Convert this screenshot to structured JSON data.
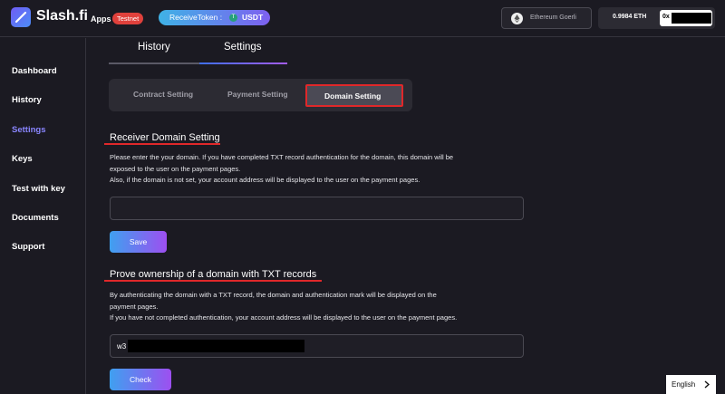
{
  "header": {
    "brand": "Slash.fi",
    "apps_label": "Apps",
    "env_badge": "Testnet",
    "token_pill": {
      "label": "ReceiveToken :",
      "token": "USDT",
      "token_icon": "tether-icon"
    },
    "network": {
      "label": "Ethereum Goerli",
      "icon": "ethereum-icon"
    },
    "balance": "0.9984 ETH",
    "address_prefix": "0x"
  },
  "sidebar": {
    "items": [
      {
        "label": "Dashboard",
        "active": false
      },
      {
        "label": "History",
        "active": false
      },
      {
        "label": "Settings",
        "active": true
      },
      {
        "label": "Keys",
        "active": false
      },
      {
        "label": "Test with key",
        "active": false
      },
      {
        "label": "Documents",
        "active": false
      },
      {
        "label": "Support",
        "active": false
      }
    ],
    "active_color": "#8a86ff"
  },
  "main_tabs": [
    {
      "label": "History",
      "active": false
    },
    {
      "label": "Settings",
      "active": true
    }
  ],
  "setting_tabs": [
    {
      "label": "Contract Setting",
      "active": false
    },
    {
      "label": "Payment Setting",
      "active": false
    },
    {
      "label": "Domain Setting",
      "active": true
    }
  ],
  "receiver_domain": {
    "title": "Receiver Domain Setting",
    "line1": "Please enter the your domain. If you have completed TXT record authentication for the domain, this domain will be",
    "line2": "exposed to the user on the payment pages.",
    "line3": "Also, if the domain is not set, your account address will be displayed to the user on the payment pages.",
    "input_value": "",
    "save_label": "Save"
  },
  "txt_records": {
    "title": "Prove ownership of a domain with TXT records",
    "line1": "By authenticating the domain with a TXT record, the domain and authentication mark will be displayed on the",
    "line2": "payment pages.",
    "line3": "If you have not completed authentication, your account address will be displayed to the user on the payment pages.",
    "input_value": "w3",
    "check_label": "Check"
  },
  "language": {
    "label": "English"
  },
  "colors": {
    "highlight": "#e0282a",
    "accent_start": "#3fa0f0",
    "accent_end": "#9d4ff0"
  }
}
